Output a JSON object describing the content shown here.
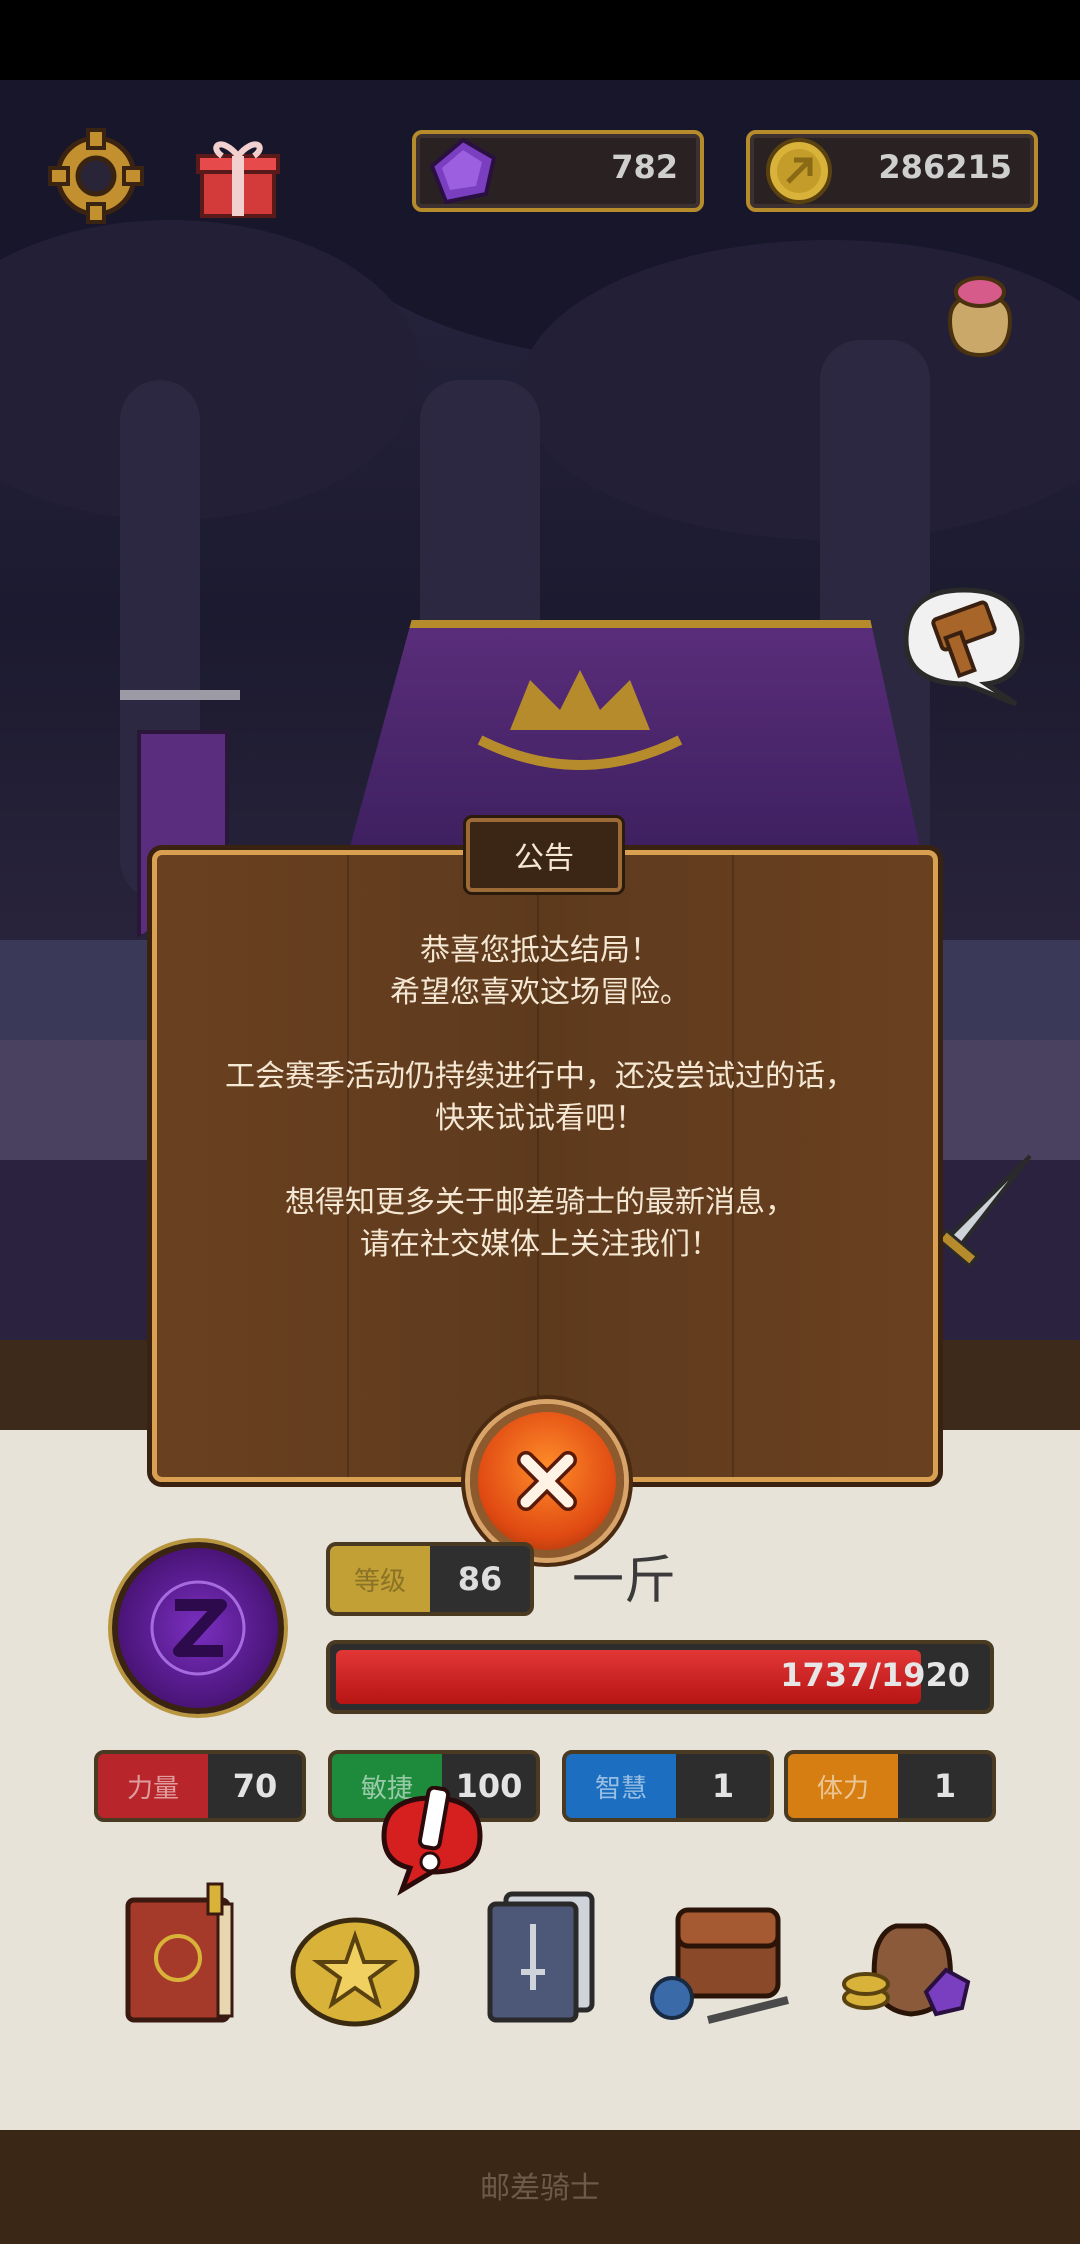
{
  "hud": {
    "gems": "782",
    "coins": "286215"
  },
  "notice": {
    "title": "公告",
    "lines": [
      "恭喜您抵达结局！",
      "希望您喜欢这场冒险。",
      "工会赛季活动仍持续进行中，还没尝试过的话，",
      "快来试试看吧！",
      "想得知更多关于邮差骑士的最新消息，",
      "请在社交媒体上关注我们！"
    ]
  },
  "player": {
    "level_label": "等级",
    "level": "86",
    "name": "一斤",
    "hp_text": "1737/1920",
    "hp_fraction": 0.905,
    "stats": [
      {
        "label": "力量",
        "value": "70",
        "color": "#b8262b"
      },
      {
        "label": "敏捷",
        "value": "100",
        "color": "#1d8a3c"
      },
      {
        "label": "智慧",
        "value": "1",
        "color": "#1c6fc0"
      },
      {
        "label": "体力",
        "value": "1",
        "color": "#d67e12"
      }
    ]
  },
  "footer": {
    "title": "邮差骑士"
  }
}
